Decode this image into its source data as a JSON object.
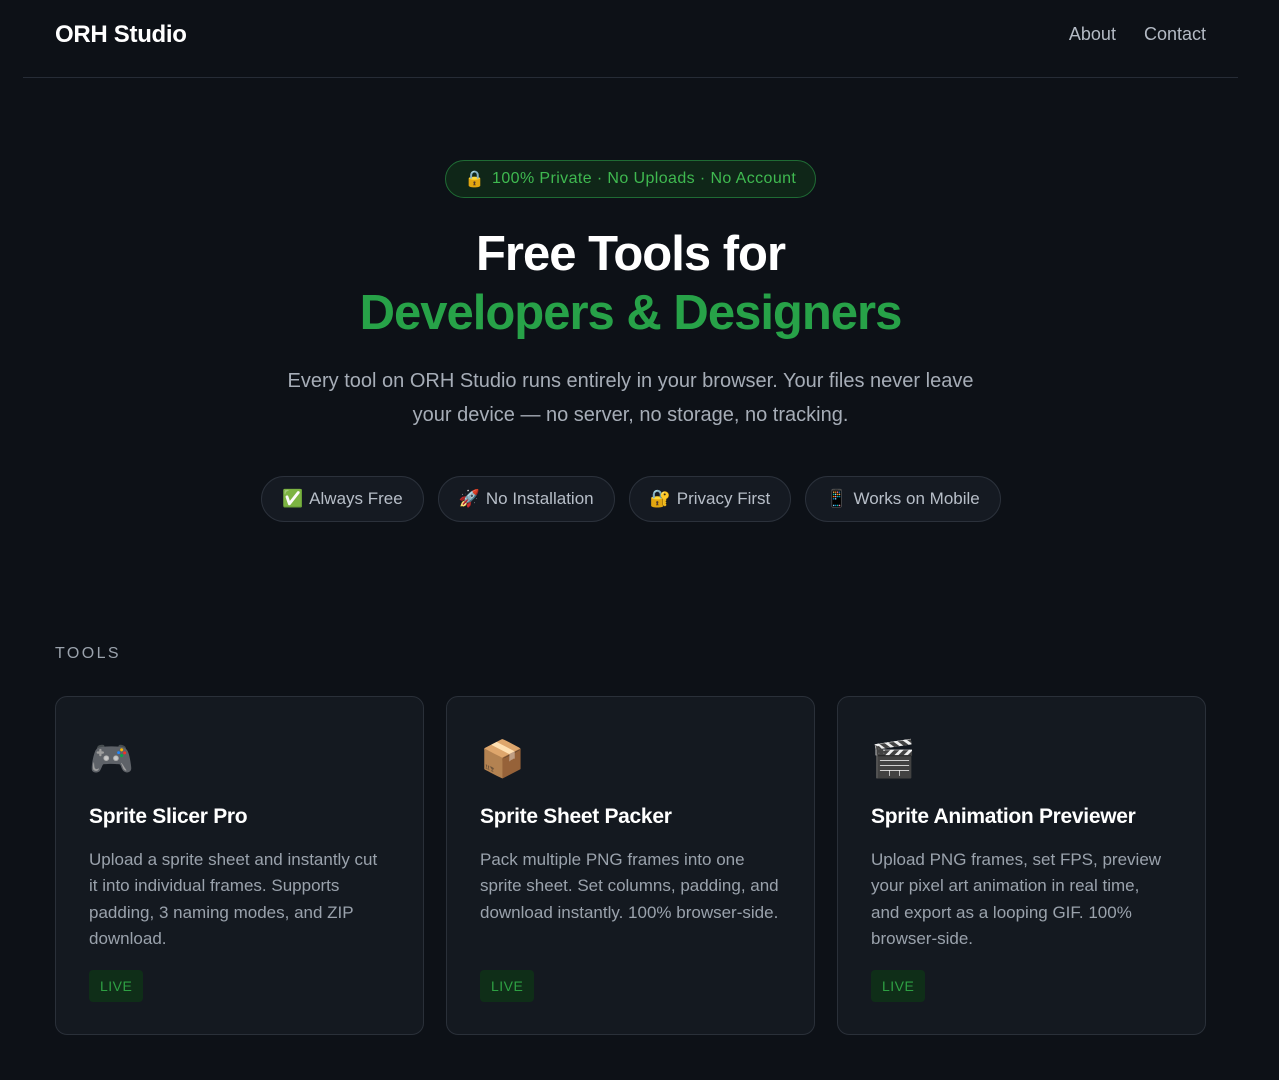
{
  "header": {
    "logo": "ORH Studio",
    "nav": [
      {
        "label": "About"
      },
      {
        "label": "Contact"
      }
    ]
  },
  "hero": {
    "badge_icon": "lock-icon",
    "badge_text": "100% Private · No Uploads · No Account",
    "title_line1": "Free Tools for",
    "title_line2": "Developers & Designers",
    "description": "Every tool on ORH Studio runs entirely in your browser. Your files never leave your device — no server, no storage, no tracking.",
    "features": [
      {
        "icon": "check-mark-icon",
        "glyph": "✅",
        "label": "Always Free"
      },
      {
        "icon": "rocket-icon",
        "glyph": "🚀",
        "label": "No Installation"
      },
      {
        "icon": "lock-key-icon",
        "glyph": "🔐",
        "label": "Privacy First"
      },
      {
        "icon": "mobile-phone-icon",
        "glyph": "📱",
        "label": "Works on Mobile"
      }
    ]
  },
  "tools": {
    "section_label": "TOOLS",
    "items": [
      {
        "icon": "game-controller-icon",
        "glyph": "🎮",
        "title": "Sprite Slicer Pro",
        "description": "Upload a sprite sheet and instantly cut it into individual frames. Supports padding, 3 naming modes, and ZIP download.",
        "status": "LIVE"
      },
      {
        "icon": "package-box-icon",
        "glyph": "📦",
        "title": "Sprite Sheet Packer",
        "description": "Pack multiple PNG frames into one sprite sheet. Set columns, padding, and download instantly. 100% browser-side.",
        "status": "LIVE"
      },
      {
        "icon": "clapper-board-icon",
        "glyph": "🎬",
        "title": "Sprite Animation Previewer",
        "description": "Upload PNG frames, set FPS, preview your pixel art animation in real time, and export as a looping GIF. 100% browser-side.",
        "status": "LIVE"
      }
    ]
  },
  "colors": {
    "background": "#0d1117",
    "accent": "#27a248",
    "card": "#141920"
  }
}
